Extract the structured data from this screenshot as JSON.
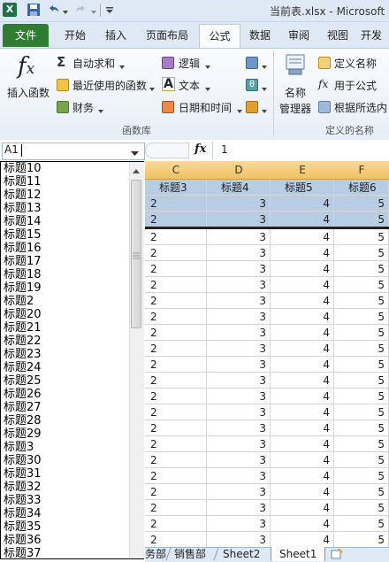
{
  "app": {
    "title": "当前表.xlsx - Microsoft",
    "brand_color": "#1e7145"
  },
  "ribbon": {
    "tabs": [
      "文件",
      "开始",
      "插入",
      "页面布局",
      "公式",
      "数据",
      "审阅",
      "视图",
      "开发"
    ],
    "active_tab": "公式",
    "function_library": {
      "insert_function": "插入函数",
      "autosum": "自动求和",
      "recent": "最近使用的函数",
      "financial": "财务",
      "logical": "逻辑",
      "text": "文本",
      "datetime": "日期和时间",
      "group_label": "函数库"
    },
    "defined_names": {
      "name_manager_1": "名称",
      "name_manager_2": "管理器",
      "define_name": "定义名称",
      "use_in_formula": "用于公式",
      "create_from_selection": "根据所选内",
      "group_label": "定义的名称"
    }
  },
  "formula_bar": {
    "name_box": "A1",
    "fx": "fx",
    "value": "1"
  },
  "grid": {
    "columns": [
      "C",
      "D",
      "E",
      "F"
    ],
    "header_row": [
      "标题3",
      "标题4",
      "标题5",
      "标题6"
    ],
    "selected_rows": [
      [
        "2",
        "3",
        "4",
        "5"
      ],
      [
        "2",
        "3",
        "4",
        "5"
      ]
    ],
    "rows_value": [
      "2",
      "3",
      "4",
      "5"
    ],
    "row_count": 20
  },
  "dropdown": {
    "items": [
      "标题10",
      "标题11",
      "标题12",
      "标题13",
      "标题14",
      "标题15",
      "标题16",
      "标题17",
      "标题18",
      "标题19",
      "标题2",
      "标题20",
      "标题21",
      "标题22",
      "标题23",
      "标题24",
      "标题25",
      "标题26",
      "标题27",
      "标题28",
      "标题29",
      "标题3",
      "标题30",
      "标题31",
      "标题32",
      "标题33",
      "标题34",
      "标题35",
      "标题36",
      "标题37"
    ]
  },
  "sheet_tabs": {
    "items": [
      "务部",
      "销售部",
      "Sheet2",
      "Sheet1"
    ],
    "active": "Sheet1"
  }
}
